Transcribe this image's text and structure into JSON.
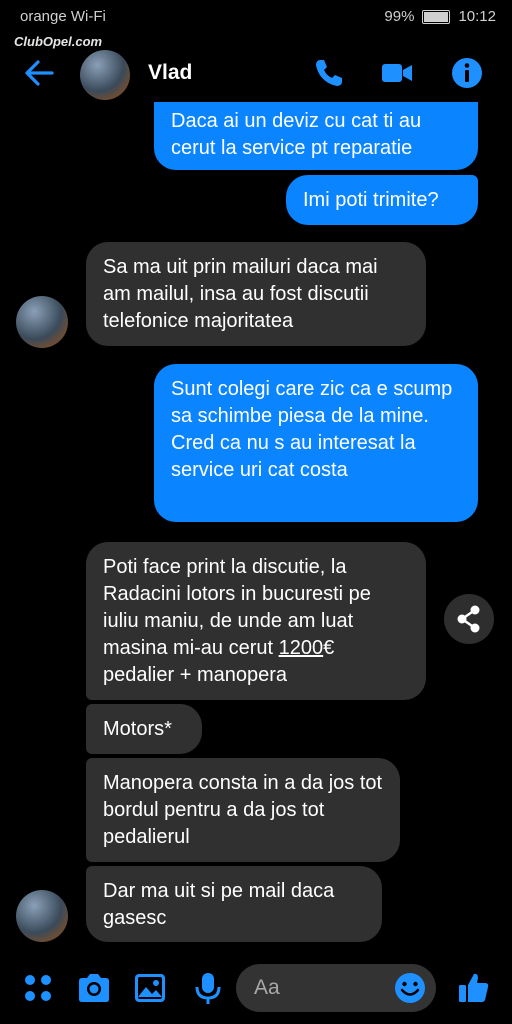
{
  "status": {
    "carrier": "orange Wi-Fi",
    "battery": "99%",
    "time": "10:12"
  },
  "watermark": "ClubOpel.com",
  "header": {
    "contact_name": "Vlad"
  },
  "messages": [
    {
      "dir": "out",
      "text": "Daca ai un deviz cu cat ti au cerut la service pt reparatie"
    },
    {
      "dir": "out",
      "text": "Imi poti trimite?"
    },
    {
      "dir": "in",
      "text": "Sa ma uit prin mailuri daca mai am mailul, insa au fost discutii telefonice majoritatea"
    },
    {
      "dir": "out",
      "text": "Sunt colegi care zic ca e scump sa schimbe piesa de la mine. Cred ca nu s au interesat la service uri cat costa"
    },
    {
      "dir": "in",
      "text_before": "Poti face print la discutie, la Radacini lotors in bucuresti pe iuliu maniu, de unde am luat masina mi-au cerut ",
      "link": "1200",
      "text_after": "€ pedalier + manopera"
    },
    {
      "dir": "in",
      "text": "Motors*"
    },
    {
      "dir": "in",
      "text": "Manopera consta in a da jos tot bordul pentru a da jos tot pedalierul"
    },
    {
      "dir": "in",
      "text": "Dar ma uit si pe mail daca gasesc"
    }
  ],
  "composer": {
    "placeholder": "Aa"
  },
  "colors": {
    "accent": "#0a84ff",
    "incoming": "#303030",
    "background": "#000000"
  },
  "icons": [
    "back-arrow-icon",
    "phone-icon",
    "video-icon",
    "info-icon",
    "share-icon",
    "apps-icon",
    "camera-icon",
    "gallery-icon",
    "mic-icon",
    "emoji-icon",
    "like-icon"
  ]
}
